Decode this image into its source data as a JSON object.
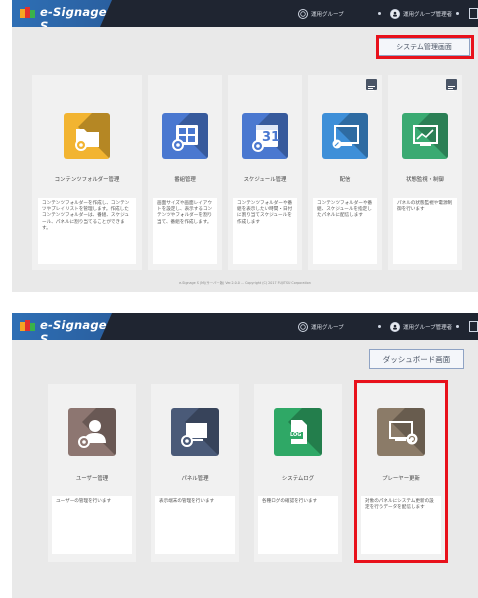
{
  "app": {
    "logo_text": "e-Signage S"
  },
  "topbar": {
    "group_label": "運用グループ",
    "user_label": "運用グループ管理者"
  },
  "screen1": {
    "mode_button": "システム管理画面",
    "cards": [
      {
        "title": "コンテンツフォルダー管理",
        "desc": "コンテンツフォルダーを作成し、コンテンツやプレイリストを管理します。作成したコンテンツフォルダーは、番組、スケジュール、パネルに割り当てることができます。",
        "color": "#f2b431"
      },
      {
        "title": "番組管理",
        "desc": "画面サイズや画面レイアウトを設定し、表示するコンテンツやフォルダーを割り当て、番組を作成します。",
        "color": "#4a78d0"
      },
      {
        "title": "スケジュール管理",
        "desc": "コンテンツフォルダーや番組を表示したい時間・日付に割り当てスケジュールを作成します",
        "color": "#4a78d0",
        "calendar_number": "31"
      },
      {
        "title": "配信",
        "desc": "コンテンツフォルダーや番組、スケジュールを指定したパネルに配信します",
        "color": "#3e8fd8"
      },
      {
        "title": "状態監視・制御",
        "desc": "パネルの状態監視や電源制御を行います",
        "color": "#3aaa72"
      }
    ],
    "footer": "e-Signage S (M)(サーバー版) Ver.2.0.0 ... Copyright (C) 2017 FUJITSU Corporation"
  },
  "screen2": {
    "mode_button": "ダッシュボード画面",
    "cards": [
      {
        "title": "ユーザー管理",
        "desc": "ユーザーの管理を行います",
        "color": "#8d7671"
      },
      {
        "title": "パネル管理",
        "desc": "表示端末の管理を行います",
        "color": "#4a5a78"
      },
      {
        "title": "システムログ",
        "desc": "各種ログの確認を行います",
        "color": "#2fa866",
        "log_label": "LOG"
      },
      {
        "title": "プレーヤー更新",
        "desc": "対象のパネルにシステム更新の設定を行うデータを配信します",
        "color": "#8b7b68"
      }
    ]
  }
}
